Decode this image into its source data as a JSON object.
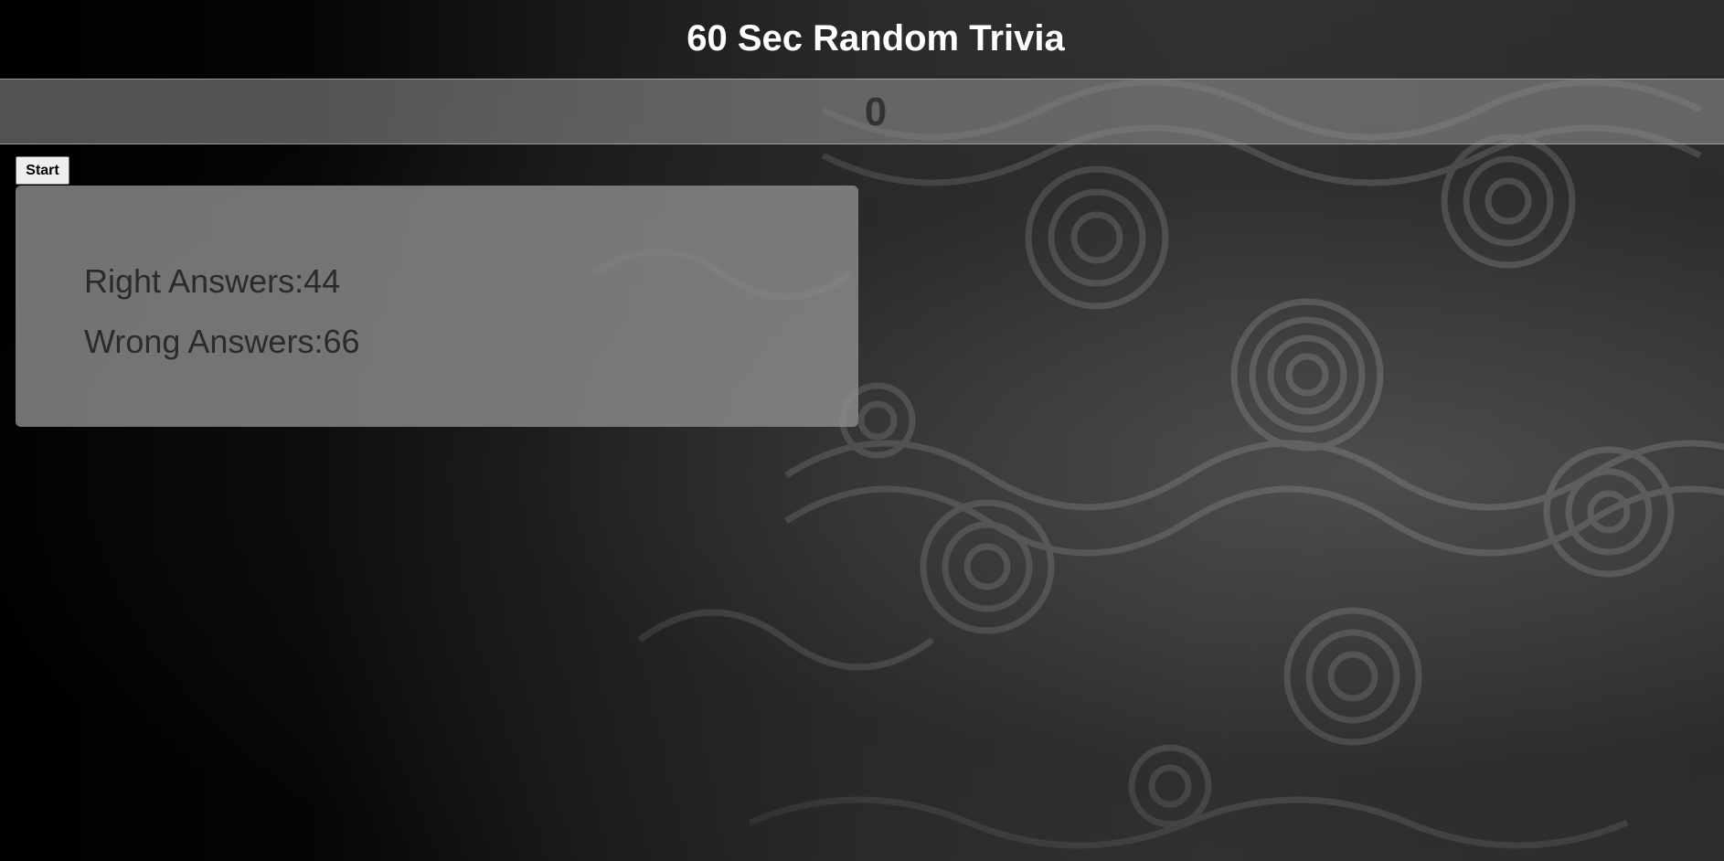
{
  "header": {
    "title": "60 Sec Random Trivia"
  },
  "timer": {
    "value": "0"
  },
  "controls": {
    "start_label": "Start"
  },
  "results": {
    "right_label": "Right Answers:",
    "right_count": "44",
    "wrong_label": "Wrong Answers:",
    "wrong_count": "66"
  },
  "colors": {
    "background": "#000000",
    "title": "#ffffff",
    "timer_bar": "#969696",
    "panel": "#8c8c8c",
    "panel_text": "#2b2b2b"
  }
}
